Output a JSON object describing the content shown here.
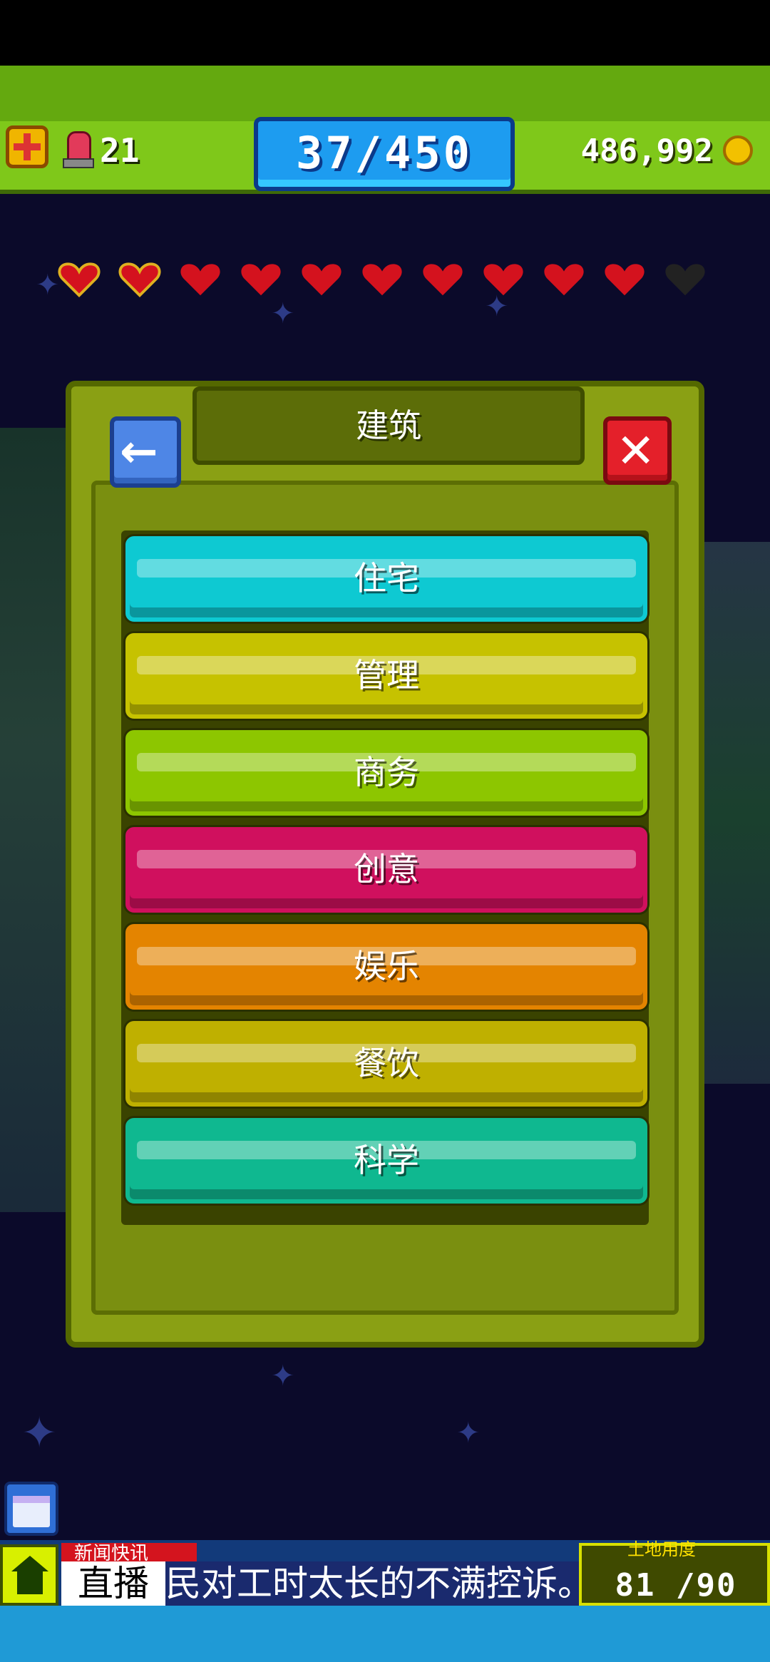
{
  "hud": {
    "alarm_count": "21",
    "population": "37/450",
    "money": "486,992"
  },
  "hearts": {
    "filled": 10,
    "total": 11,
    "colors": {
      "filled": "#d4121e",
      "outlined": "#e0b020",
      "empty": "#222"
    }
  },
  "dialog": {
    "title": "建筑",
    "back_icon": "←",
    "close_icon": "✕",
    "categories": [
      {
        "label": "住宅",
        "color": "#0ec9d2"
      },
      {
        "label": "管理",
        "color": "#c6c200"
      },
      {
        "label": "商务",
        "color": "#8dc600"
      },
      {
        "label": "创意",
        "color": "#d0105e"
      },
      {
        "label": "娱乐",
        "color": "#e48400"
      },
      {
        "label": "餐饮",
        "color": "#bfb000"
      },
      {
        "label": "科学",
        "color": "#0fb890"
      }
    ]
  },
  "news": {
    "tag": "新闻快讯",
    "live": "直播",
    "ticker": "民对工时太长的不满控诉。"
  },
  "land": {
    "label": "土地用度",
    "count": "81 /90"
  }
}
